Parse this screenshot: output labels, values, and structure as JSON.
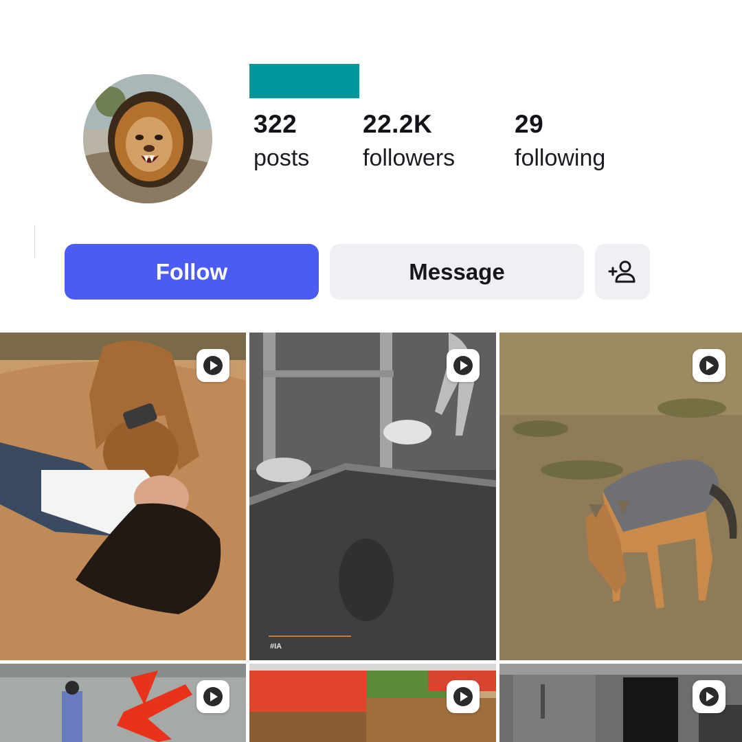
{
  "profile": {
    "avatar_icon": "lion-avatar",
    "name_highlight_color": "#00979c",
    "stats": {
      "posts": {
        "value": "322",
        "label": "posts"
      },
      "followers": {
        "value": "22.2K",
        "label": "followers"
      },
      "following": {
        "value": "29",
        "label": "following"
      }
    }
  },
  "actions": {
    "follow_label": "Follow",
    "message_label": "Message",
    "add_user_icon": "add-user-icon",
    "follow_color": "#4b5cf5"
  },
  "grid": {
    "play_icon": "play-icon",
    "posts": [
      {
        "type": "video",
        "scene": "dog-and-woman"
      },
      {
        "type": "video",
        "scene": "night-camera",
        "tag": "#IA"
      },
      {
        "type": "video",
        "scene": "jackal-savanna"
      },
      {
        "type": "video",
        "scene": "street-arrow"
      },
      {
        "type": "video",
        "scene": "market-produce"
      },
      {
        "type": "video",
        "scene": "garage-interior"
      }
    ]
  }
}
